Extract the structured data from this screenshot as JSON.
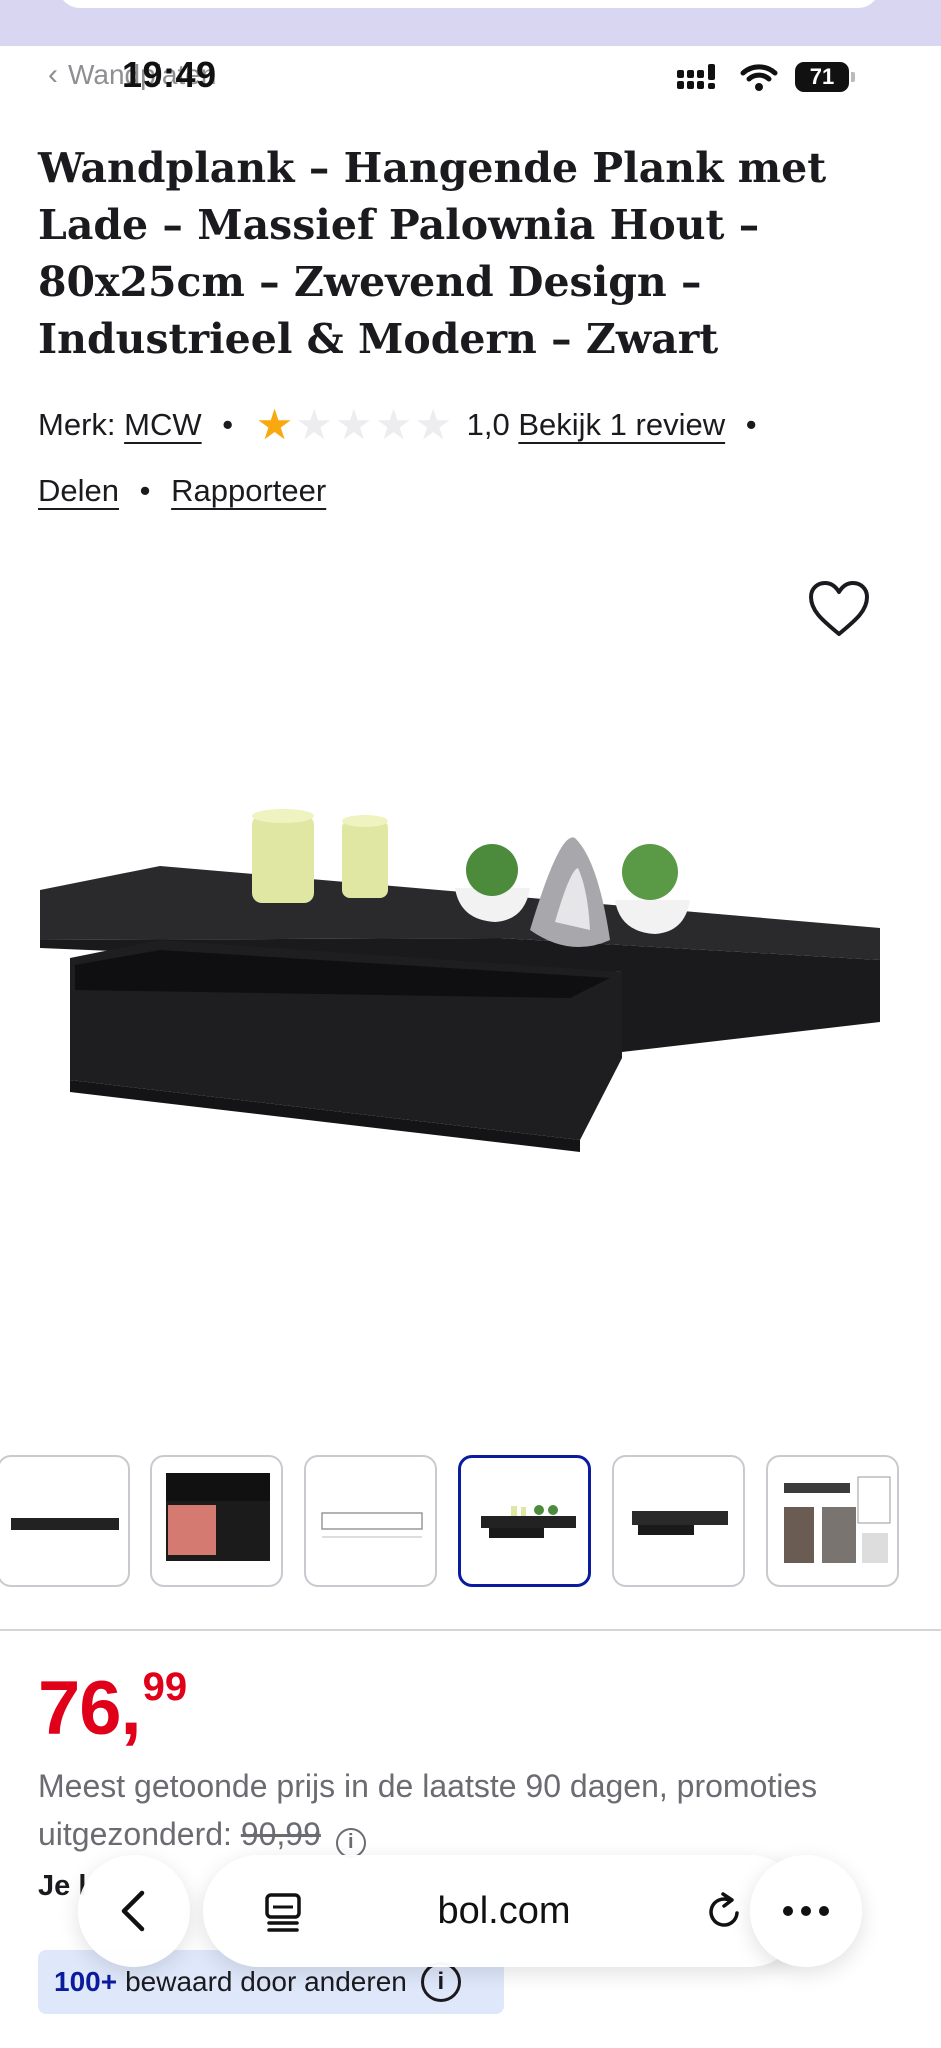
{
  "status_bar": {
    "time": "19:49",
    "back_link": "Wandplaten",
    "battery": "71"
  },
  "product": {
    "title": "Wandplank – Hangende Plank met Lade – Massief Palownia Hout – 80x25cm – Zwevend Design – Industrieel & Modern – Zwart",
    "brand_label": "Merk:",
    "brand": "MCW",
    "rating": "1,0",
    "rating_value": 1,
    "rating_max": 5,
    "review_link": "Bekijk 1 review",
    "share": "Delen",
    "report": "Rapporteer"
  },
  "gallery": {
    "thumbnail_count": 6,
    "active_index": 3
  },
  "price": {
    "integer": "76,",
    "decimals": "99",
    "note": "Meest getoonde prijs in de laatste 90 dagen, promoties uitgezonderd:",
    "old_price": "90,99",
    "partial_text": "Je l"
  },
  "browser_bar": {
    "url": "bol.com"
  },
  "badge": {
    "count": "100+",
    "text": "bewaard door anderen"
  },
  "colors": {
    "price_red": "#e0001a",
    "brand_blue": "#0b1b9e",
    "star_yellow": "#f9a90f",
    "badge_bg": "#dfe8fb"
  },
  "icons": [
    "chevron-left-icon",
    "signal-icon",
    "wifi-icon",
    "battery-icon",
    "star-icon",
    "heart-icon",
    "info-icon",
    "back-arrow-icon",
    "tabs-icon",
    "reload-icon",
    "more-icon"
  ]
}
